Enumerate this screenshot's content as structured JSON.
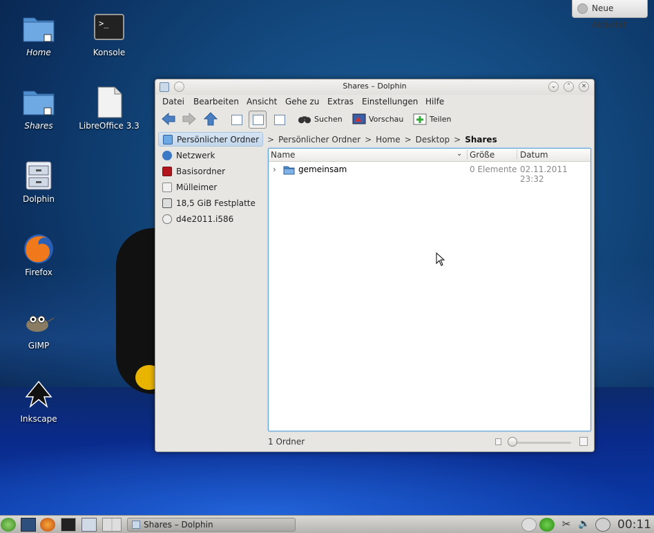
{
  "desktop": {
    "icons": [
      {
        "label": "Home"
      },
      {
        "label": "Konsole"
      },
      {
        "label": "Shares"
      },
      {
        "label": "LibreOffice 3.3"
      },
      {
        "label": "Dolphin"
      },
      {
        "label": "Firefox"
      },
      {
        "label": "GIMP"
      },
      {
        "label": "Inkscape"
      }
    ],
    "activity_button": "Neue Aktivität"
  },
  "window": {
    "title": "Shares – Dolphin",
    "menu": [
      "Datei",
      "Bearbeiten",
      "Ansicht",
      "Gehe zu",
      "Extras",
      "Einstellungen",
      "Hilfe"
    ],
    "toolbar": {
      "search": "Suchen",
      "preview": "Vorschau",
      "split": "Teilen"
    },
    "places": [
      {
        "label": "Persönlicher Ordner",
        "icon": "home-icon"
      },
      {
        "label": "Netzwerk",
        "icon": "network-icon"
      },
      {
        "label": "Basisordner",
        "icon": "root-folder-icon"
      },
      {
        "label": "Mülleimer",
        "icon": "trash-icon"
      },
      {
        "label": "18,5 GiB Festplatte",
        "icon": "harddisk-icon"
      },
      {
        "label": "d4e2011.i586",
        "icon": "optical-disc-icon"
      }
    ],
    "breadcrumb": [
      "Persönlicher Ordner",
      "Home",
      "Desktop",
      "Shares"
    ],
    "columns": {
      "name": "Name",
      "size": "Größe",
      "date": "Datum"
    },
    "files": [
      {
        "name": "gemeinsam",
        "size": "0 Elemente",
        "date": "02.11.2011 23:32"
      }
    ],
    "status": "1 Ordner"
  },
  "taskbar": {
    "task_label": "Shares – Dolphin",
    "clock": "00:11"
  },
  "colors": {
    "selection": "#c3d7ec",
    "focus_border": "#5ca1d9"
  }
}
